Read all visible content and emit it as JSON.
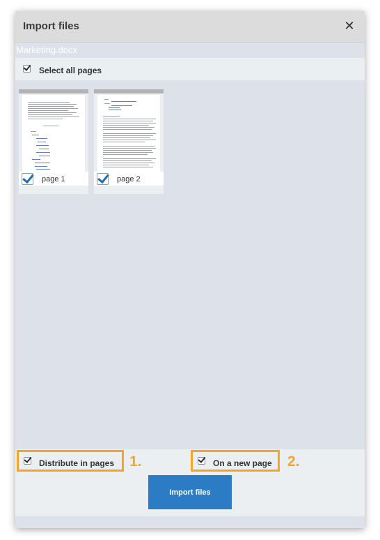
{
  "dialog": {
    "title": "Import files",
    "close_icon": "close-icon",
    "file_name": "Marketing.docx"
  },
  "select_all": {
    "label": "Select all pages",
    "checked": true
  },
  "pages": [
    {
      "label": "page 1",
      "checked": true
    },
    {
      "label": "page 2",
      "checked": true
    }
  ],
  "options": {
    "distribute": {
      "label": "Distribute in pages",
      "checked": true,
      "step": "1."
    },
    "new_page": {
      "label": "On a new page",
      "checked": true,
      "step": "2."
    }
  },
  "import_button": {
    "label": "Import files"
  },
  "colors": {
    "accent": "#2b7cc4",
    "highlight": "#f3a526",
    "check_blue": "#1f6db3"
  }
}
